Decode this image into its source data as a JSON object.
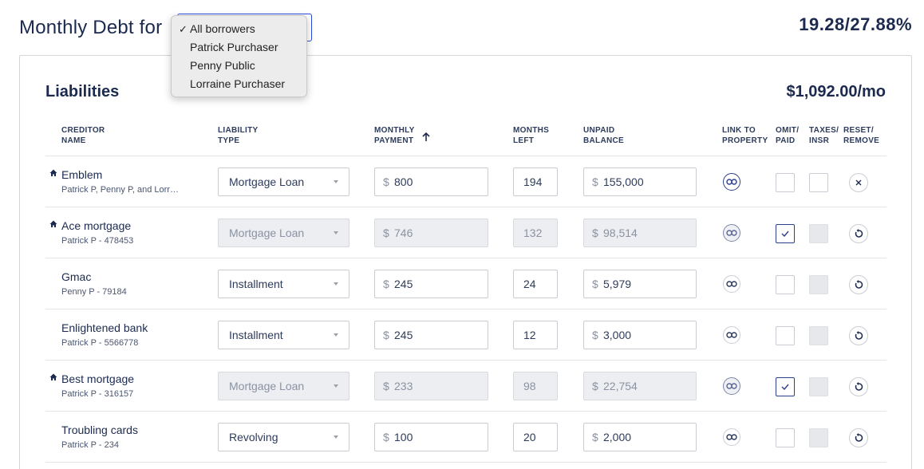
{
  "header": {
    "title": "Monthly Debt for",
    "ratio": "19.28/27.88%"
  },
  "borrower_dropdown": {
    "selected": "All borrowers",
    "options": [
      "All borrowers",
      "Patrick Purchaser",
      "Penny Public",
      "Lorraine Purchaser"
    ]
  },
  "liabilities": {
    "title": "Liabilities",
    "total": "$1,092.00/mo",
    "columns": {
      "creditor_1": "CREDITOR",
      "creditor_2": "NAME",
      "type_1": "LIABILITY",
      "type_2": "TYPE",
      "payment_1": "MONTHLY",
      "payment_2": "PAYMENT",
      "months_1": "MONTHS",
      "months_2": "LEFT",
      "balance_1": "UNPAID",
      "balance_2": "BALANCE",
      "link_1": "LINK TO",
      "link_2": "PROPERTY",
      "omit_1": "OMIT/",
      "omit_2": "PAID",
      "taxes_1": "TAXES/",
      "taxes_2": "INSR",
      "reset_1": "RESET/",
      "reset_2": "REMOVE"
    },
    "currency_symbol": "$",
    "rows": [
      {
        "name": "Emblem",
        "sub": "Patrick P, Penny P, and Lorr…",
        "type": "Mortgage Loan",
        "payment": "800",
        "months": "194",
        "balance": "155,000",
        "home_icon": true,
        "disabled": false,
        "omit_checked": false,
        "action": "remove"
      },
      {
        "name": "Ace mortgage",
        "sub": "Patrick P - 478453",
        "type": "Mortgage Loan",
        "payment": "746",
        "months": "132",
        "balance": "98,514",
        "home_icon": true,
        "disabled": true,
        "omit_checked": true,
        "action": "reset"
      },
      {
        "name": "Gmac",
        "sub": "Penny P - 79184",
        "type": "Installment",
        "payment": "245",
        "months": "24",
        "balance": "5,979",
        "home_icon": false,
        "disabled": false,
        "omit_checked": false,
        "action": "reset"
      },
      {
        "name": "Enlightened bank",
        "sub": "Patrick P - 5566778",
        "type": "Installment",
        "payment": "245",
        "months": "12",
        "balance": "3,000",
        "home_icon": false,
        "disabled": false,
        "omit_checked": false,
        "action": "reset"
      },
      {
        "name": "Best mortgage",
        "sub": "Patrick P - 316157",
        "type": "Mortgage Loan",
        "payment": "233",
        "months": "98",
        "balance": "22,754",
        "home_icon": true,
        "disabled": true,
        "omit_checked": true,
        "action": "reset"
      },
      {
        "name": "Troubling cards",
        "sub": "Patrick P - 234",
        "type": "Revolving",
        "payment": "100",
        "months": "20",
        "balance": "2,000",
        "home_icon": false,
        "disabled": false,
        "omit_checked": false,
        "action": "reset"
      }
    ]
  }
}
